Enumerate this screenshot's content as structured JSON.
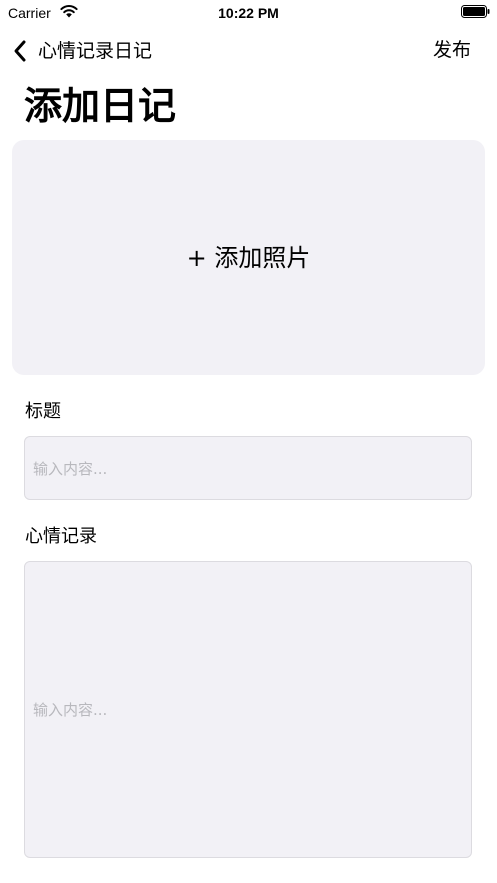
{
  "status_bar": {
    "carrier": "Carrier",
    "time": "10:22 PM"
  },
  "nav": {
    "back_label": "心情记录日记",
    "action_label": "发布"
  },
  "page": {
    "title": "添加日记"
  },
  "photo": {
    "label": "+ 添加照片"
  },
  "form": {
    "title_label": "标题",
    "title_placeholder": "输入内容...",
    "mood_label": "心情记录",
    "mood_placeholder": "输入内容..."
  },
  "colors": {
    "field_background": "#f2f1f6",
    "placeholder": "#b8b8bd",
    "text": "#000000"
  },
  "icons": {
    "back": "chevron-left-icon",
    "wifi": "wifi-icon",
    "battery": "battery-icon"
  }
}
